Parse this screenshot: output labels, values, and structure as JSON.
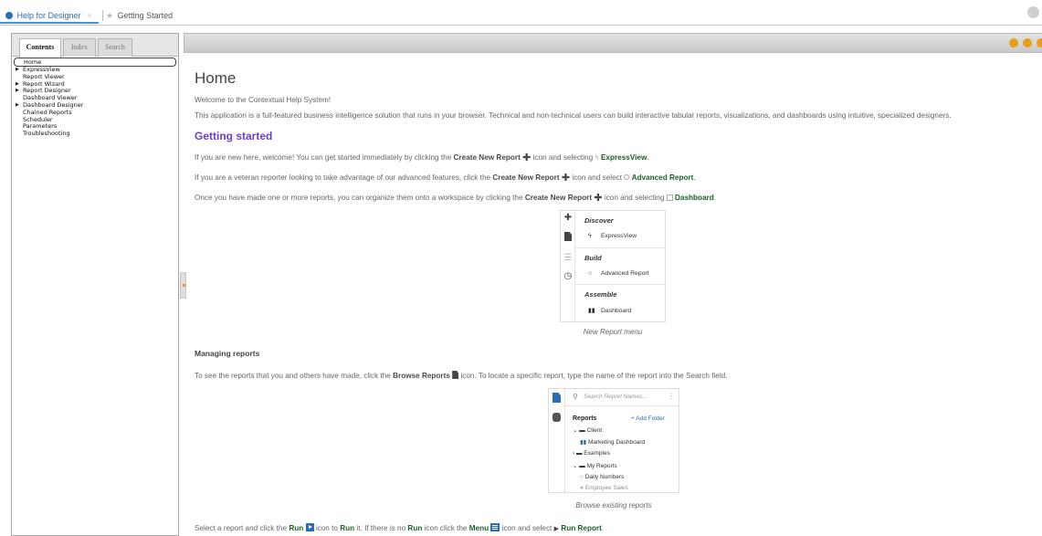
{
  "tabs": [
    {
      "label": "Help for Designer",
      "active": true
    },
    {
      "label": "Getting Started",
      "active": false
    }
  ],
  "left_panel": {
    "tabs": [
      "Contents",
      "Index",
      "Search"
    ],
    "tree": [
      {
        "label": "Home",
        "selected": true,
        "expandable": false
      },
      {
        "label": "ExpressView",
        "expandable": true
      },
      {
        "label": "Report Viewer",
        "expandable": false
      },
      {
        "label": "Report Wizard",
        "expandable": true
      },
      {
        "label": "Report Designer",
        "expandable": true
      },
      {
        "label": "Dashboard Viewer",
        "expandable": false
      },
      {
        "label": "Dashboard Designer",
        "expandable": true
      },
      {
        "label": "Chained Reports",
        "expandable": false
      },
      {
        "label": "Scheduler",
        "expandable": false
      },
      {
        "label": "Parameters",
        "expandable": false
      },
      {
        "label": "Troubleshooting",
        "expandable": false
      }
    ]
  },
  "content": {
    "title": "Home",
    "intro1": "Welcome to the Contextual Help System!",
    "intro2": "This application is a full-featured business intelligence solution that runs in your browser. Technical and non-technical users can build interactive tabular reports, visualizations, and dashboards using intuitive, specialized designers.",
    "getting_started": "Getting started",
    "gs1_a": "If you are new here, welcome! You can get started immediately by clicking the",
    "gs1_b": "icon and selecting",
    "gs2_a": "If you are a veteran reporter looking to take advantage of our advanced features, click the",
    "gs2_b": "icon and select",
    "gs3_a": "Once you have made one or more reports, you can organize them onto a workspace by clicking the",
    "gs3_b": "icon and selecting",
    "create_new_report": "Create New Report",
    "expressview": "ExpressView",
    "advanced_report": "Advanced Report",
    "dashboard": "Dashboard",
    "period": ".",
    "managing_reports": "Managing reports",
    "mr_a": "To see the reports that you and others have made, click the",
    "browse_reports": "Browse Reports",
    "mr_b": "icon. To locate a specific report, type the name of the report into the Search field.",
    "run_a": "Select a report and click the",
    "run": "Run",
    "run_b": "icon to",
    "run_c": "it. If there is no",
    "run_d": "icon click the",
    "menu": "Menu",
    "run_e": "icon and select",
    "run_report": "Run Report"
  },
  "figure_new_report": {
    "caption": "New Report menu",
    "sections": [
      {
        "header": "Discover",
        "item": "ExpressView",
        "item_icon": "bolt-icon"
      },
      {
        "header": "Build",
        "item": "Advanced Report",
        "item_icon": "circle-icon"
      },
      {
        "header": "Assemble",
        "item": "Dashboard",
        "item_icon": "dashboard-icon"
      }
    ],
    "rail_icons": [
      "plus-icon",
      "document-icon",
      "database-icon",
      "clock-icon"
    ]
  },
  "figure_browse": {
    "caption": "Browse existing reports",
    "search_placeholder": "Search Report Names...",
    "reports_label": "Reports",
    "add_folder": "+ Add Folder",
    "items": [
      {
        "label": "Client",
        "kind": "folder-open",
        "indent": 0
      },
      {
        "label": "Marketing Dashboard",
        "kind": "dashboard",
        "indent": 1
      },
      {
        "label": "Examples",
        "kind": "folder-closed",
        "indent": 0
      },
      {
        "label": "My Reports",
        "kind": "folder-open",
        "indent": 0
      },
      {
        "label": "Daily Numbers",
        "kind": "report",
        "indent": 1
      },
      {
        "label": "Employee Sales",
        "kind": "report",
        "indent": 1
      }
    ]
  },
  "colors": {
    "accent": "#2a6fb5",
    "heading": "#6a3dd6",
    "link_green": "#1c5f2a",
    "toolbar_dot": "#e6a017"
  }
}
